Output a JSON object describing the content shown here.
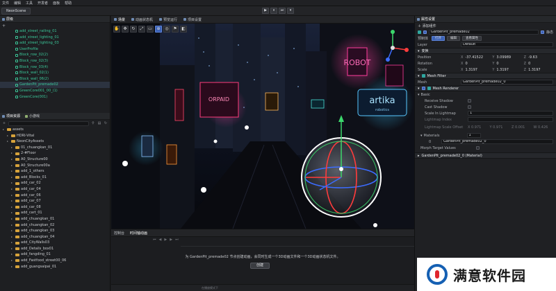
{
  "menubar": [
    "文件",
    "编辑",
    "工具",
    "开发者",
    "面板",
    "帮助"
  ],
  "document_tab": "NeonScene",
  "play_controls": [
    "▶",
    "⏸",
    "⏭",
    "▾"
  ],
  "hierarchy": {
    "title": "层级",
    "items": [
      "add_street_railing_01",
      "add_street_lighting_01",
      "add_street_lighting_03",
      "UserProfile",
      "Block_row_02(2)",
      "Block_row_02(3)",
      "Block_row_03(4)",
      "Block_wall_02(1)",
      "Block_wall_06(2)",
      "GardenPit_premade02",
      "GreenCore001_00_(1)",
      "GreenCore(001)"
    ],
    "selected_index": 9
  },
  "assets": {
    "tabs": [
      "项目资源",
      "小游戏"
    ],
    "items": [
      {
        "label": "assets",
        "depth": 0
      },
      {
        "label": "HDRI-Vital",
        "depth": 1
      },
      {
        "label": "NeonCityAssets",
        "depth": 1
      },
      {
        "label": "01_chuangkan_01",
        "depth": 2
      },
      {
        "label": "2-#Floor",
        "depth": 2
      },
      {
        "label": "A0_Structure00",
        "depth": 2
      },
      {
        "label": "A0_Structure00a",
        "depth": 2
      },
      {
        "label": "add_1_others",
        "depth": 2
      },
      {
        "label": "add_Blocks_01",
        "depth": 2
      },
      {
        "label": "add_car_02",
        "depth": 2
      },
      {
        "label": "add_car_04",
        "depth": 2
      },
      {
        "label": "add_car_06",
        "depth": 2
      },
      {
        "label": "add_car_07",
        "depth": 2
      },
      {
        "label": "add_car_08",
        "depth": 2
      },
      {
        "label": "add_cart_01",
        "depth": 2
      },
      {
        "label": "add_chuangkan_01",
        "depth": 2
      },
      {
        "label": "add_chuangkan_02",
        "depth": 2
      },
      {
        "label": "add_chuangkan_03",
        "depth": 2
      },
      {
        "label": "add_chuangkan_04",
        "depth": 2
      },
      {
        "label": "add_CityWalls03",
        "depth": 2
      },
      {
        "label": "add_Details_box01",
        "depth": 2
      },
      {
        "label": "add_fangding_01",
        "depth": 2
      },
      {
        "label": "add_Fastfood_street00_06",
        "depth": 2
      },
      {
        "label": "add_guangsaipai_01",
        "depth": 2
      }
    ]
  },
  "scene_tabs": [
    "场景",
    "动画状态机",
    "预览运行",
    "项目设置"
  ],
  "scene_text": {
    "sign_right": "artika",
    "sign_right_sub": "robotics",
    "sign_top": "ROBOT",
    "sign_left": "ORPAID"
  },
  "timeline": {
    "tabs": [
      "控制台",
      "时间轴动画"
    ],
    "message": "为 GardenPit_premade02 节点创建动画，会同时生成一个3D动画文件和一个3D动画状态机文件。",
    "create_button": "创建",
    "bottom_hint": "在播放模式下"
  },
  "inspector": {
    "title": "属性设置",
    "add_component": "添加组件",
    "node_name": "GardenPit_premade02",
    "static_label": "静态",
    "buttons": [
      "预制体",
      "打开",
      "编辑",
      "查看属性"
    ],
    "layer_label": "Layer",
    "layer_value": "Default",
    "transform_title": "变换",
    "position": [
      "-37.41522",
      "3.09989",
      "-9.63"
    ],
    "rotation": [
      "0",
      "0",
      "0"
    ],
    "scale": [
      "1.3197",
      "1.3197",
      "1.3197"
    ],
    "position_label": "Position",
    "rotation_label": "Rotation",
    "scale_label": "Scale",
    "mesh_filter_title": "Mesh Filter",
    "mesh_label": "Mesh",
    "mesh_value": "GardenPit_premade02_0",
    "mesh_renderer_title": "Mesh Renderer",
    "basic_label": "Basic",
    "receive_shadow": "Receive Shadow",
    "cast_shadow": "Cast Shadow",
    "scale_lightmap": "Scale In Lightmap",
    "scale_lightmap_value": "1",
    "lightmap_index": "Lightmap Index",
    "lightmap_scale_offset": "Lightmap Scale Offset",
    "lso_values": [
      "X 0.971",
      "Y 0.971",
      "Z 0.001",
      "W 0.426"
    ],
    "materials_label": "Materials",
    "materials_count": "1",
    "material_index": "0",
    "material_value": "GardenPit_premade02_0",
    "morph_label": "Morph Target Values",
    "material_footer": "GardenPit_premade02_0 (Material)"
  },
  "watermark": "满意软件园",
  "colors": {
    "accent": "#3d63b6",
    "hierarchy_text": "#3bc89a",
    "background": "#1b1c1f"
  }
}
